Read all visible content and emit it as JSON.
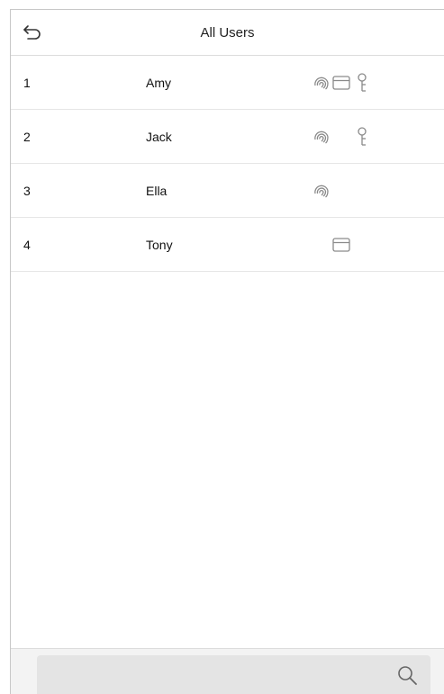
{
  "header": {
    "title": "All Users",
    "back_icon": "back-arrow-icon"
  },
  "users": [
    {
      "no": "1",
      "name": "Amy",
      "fingerprint": true,
      "card": true,
      "password": true
    },
    {
      "no": "2",
      "name": "Jack",
      "fingerprint": true,
      "card": false,
      "password": true
    },
    {
      "no": "3",
      "name": "Ella",
      "fingerprint": true,
      "card": false,
      "password": false
    },
    {
      "no": "4",
      "name": "Tony",
      "fingerprint": false,
      "card": true,
      "password": false
    }
  ],
  "search": {
    "value": "",
    "icon": "search-icon"
  },
  "colors": {
    "icon_gray": "#8a8a8a",
    "divider": "#e6e6e6",
    "search_bg": "#e4e4e4"
  }
}
